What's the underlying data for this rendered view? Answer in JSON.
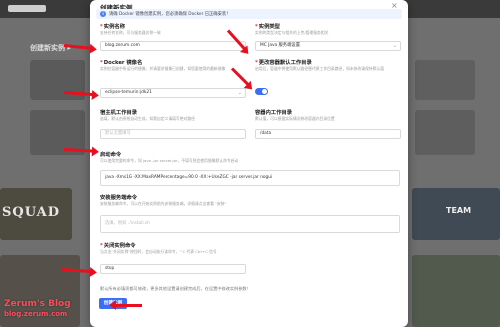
{
  "dialog": {
    "title": "创建新实例",
    "close_glyph": "×",
    "alert_text": "请确 Docker 镜像创建实例，您必须确保 Docker 已正确安装！"
  },
  "form": {
    "instance_name": {
      "label": "实例名称",
      "hint": "支持任何名称，可与服务器名称一致",
      "value": "blog.zerum.com"
    },
    "instance_type": {
      "label": "实例类型",
      "hint": "实例的类型决定与相关的上传/管理服务相关",
      "value": "MC Java 服务端设置"
    },
    "docker_image": {
      "label": "Docker 镜像名",
      "hint": "实例在容器中所运行的镜像，并请要求镜像已创建，如您要使用的最新镜像",
      "value": "eclipse-temurin:jdk21"
    },
    "workdir_toggle": {
      "label": "更改容器默认工作目录",
      "hint": "启用后，容器中将使用默认路径替代原工作目录路径，如未修改请保持默认值"
    },
    "host_workdir": {
      "label": "宿主机工作目录",
      "hint": "选填，默认由系统自动生成，如需自定义请填写绝对路径",
      "placeholder": "默认无需填写"
    },
    "container_workdir": {
      "label": "容器内工作目录",
      "hint": "默认值，可以根据实际情况修改容器内目录位置",
      "value": "/data"
    },
    "start_command": {
      "label": "启动命令",
      "hint": "可以使用完整的命令，如 java -jar server.jar，不填写则会使用镜像默认命令启动",
      "value": "java -Xms1G -XX:MaxRAMPercentage=90.0 -XX:+UseZGC -jar server.jar nogui"
    },
    "install_command": {
      "label": "安装服务端命令",
      "hint": "安装服务端命令，可以在开始实例前先安装服务端，详细请点击查看 \"安装\"",
      "placeholder": "选填，例如 ./install.sh"
    },
    "stop_command": {
      "label": "关闭实例命令",
      "hint": "当点击\"关闭实例\"按钮时，会自动执行该命令，^C 代表 Ctrl+C 信号",
      "value": "stop"
    }
  },
  "footer_note": "默认所有必填项都可修改，更多其他设置请创建完成后，在设置中修改实例参数！",
  "create_button": "创建实例",
  "background": {
    "title": "创建新实例 ▸",
    "game_text": "SQUAD",
    "steam_text": "TEAM"
  },
  "watermark": {
    "line1": "Zerum's Blog",
    "line2": "blog.zerum.com"
  },
  "colors": {
    "accent": "#3b6ef2",
    "required": "#e53935",
    "arrow": "#e8101e",
    "watermark": "#ff4a5a"
  }
}
